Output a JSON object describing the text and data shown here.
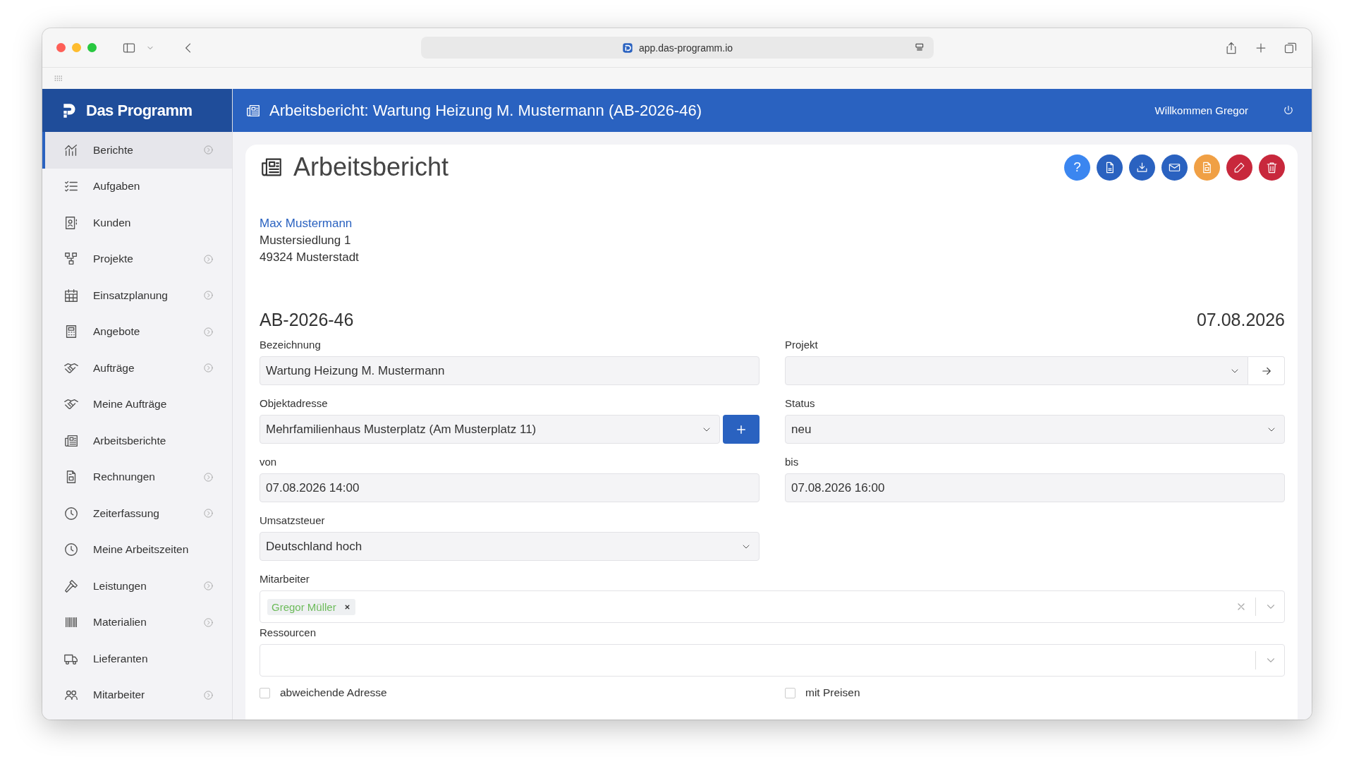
{
  "browser": {
    "url": "app.das-programm.io"
  },
  "app": {
    "logo": "Das Programm",
    "header_title": "Arbeitsbericht: Wartung Heizung M. Mustermann (AB-2026-46)",
    "welcome": "Willkommen Gregor"
  },
  "sidebar": {
    "items": [
      {
        "label": "Berichte",
        "kind": "chart",
        "selected": true,
        "expandable": true
      },
      {
        "label": "Aufgaben",
        "kind": "tasks",
        "selected": false,
        "expandable": false
      },
      {
        "label": "Kunden",
        "kind": "contacts",
        "selected": false,
        "expandable": false
      },
      {
        "label": "Projekte",
        "kind": "project",
        "selected": false,
        "expandable": true
      },
      {
        "label": "Einsatzplanung",
        "kind": "calendar",
        "selected": false,
        "expandable": true
      },
      {
        "label": "Angebote",
        "kind": "calculator",
        "selected": false,
        "expandable": true
      },
      {
        "label": "Aufträge",
        "kind": "handshake",
        "selected": false,
        "expandable": true
      },
      {
        "label": "Meine Aufträge",
        "kind": "handshake",
        "selected": false,
        "expandable": false
      },
      {
        "label": "Arbeitsberichte",
        "kind": "newspaper",
        "selected": false,
        "expandable": false
      },
      {
        "label": "Rechnungen",
        "kind": "invoice",
        "selected": false,
        "expandable": true
      },
      {
        "label": "Zeiterfassung",
        "kind": "clock",
        "selected": false,
        "expandable": true
      },
      {
        "label": "Meine Arbeitszeiten",
        "kind": "clock",
        "selected": false,
        "expandable": false
      },
      {
        "label": "Leistungen",
        "kind": "hammer",
        "selected": false,
        "expandable": true
      },
      {
        "label": "Materialien",
        "kind": "barcode",
        "selected": false,
        "expandable": true
      },
      {
        "label": "Lieferanten",
        "kind": "truck",
        "selected": false,
        "expandable": false
      },
      {
        "label": "Mitarbeiter",
        "kind": "people",
        "selected": false,
        "expandable": true
      }
    ]
  },
  "page": {
    "title": "Arbeitsbericht",
    "actions": [
      {
        "kind": "help",
        "label": "?",
        "color": "#3b86f0"
      },
      {
        "kind": "pdf",
        "color": "#2a62c0"
      },
      {
        "kind": "download",
        "color": "#2a62c0"
      },
      {
        "kind": "mail",
        "color": "#2a62c0"
      },
      {
        "kind": "document",
        "color": "#f0a045"
      },
      {
        "kind": "edit",
        "color": "#c8283c"
      },
      {
        "kind": "delete",
        "color": "#c8283c"
      }
    ]
  },
  "customer": {
    "name": "Max Mustermann",
    "street": "Mustersiedlung 1",
    "city": "49324 Musterstadt"
  },
  "report": {
    "number": "AB-2026-46",
    "date": "07.08.2026"
  },
  "form": {
    "fields": [
      {
        "kind": "text",
        "label": "Bezeichnung",
        "value": "Wartung Heizung M. Mustermann"
      },
      {
        "kind": "select-link",
        "label": "Projekt"
      },
      {
        "kind": "select-add",
        "label": "Objektadresse",
        "value": "Mehrfamilienhaus Musterplatz (Am Musterplatz 11)"
      },
      {
        "kind": "select",
        "label": "Status",
        "value": "neu"
      },
      {
        "kind": "text",
        "label": "von",
        "value": "07.08.2026 14:00"
      },
      {
        "kind": "text",
        "label": "bis",
        "value": "07.08.2026 16:00"
      },
      {
        "kind": "select",
        "label": "Umsatzsteuer",
        "value": "Deutschland hoch"
      },
      {
        "kind": "multi",
        "label": "Mitarbeiter",
        "tags": [
          {
            "label": "Gregor Müller"
          }
        ]
      },
      {
        "kind": "multi",
        "label": "Ressourcen"
      }
    ],
    "checkboxes": [
      {
        "label": "abweichende Adresse",
        "checked": false
      },
      {
        "label": "mit Preisen",
        "checked": false
      }
    ]
  }
}
